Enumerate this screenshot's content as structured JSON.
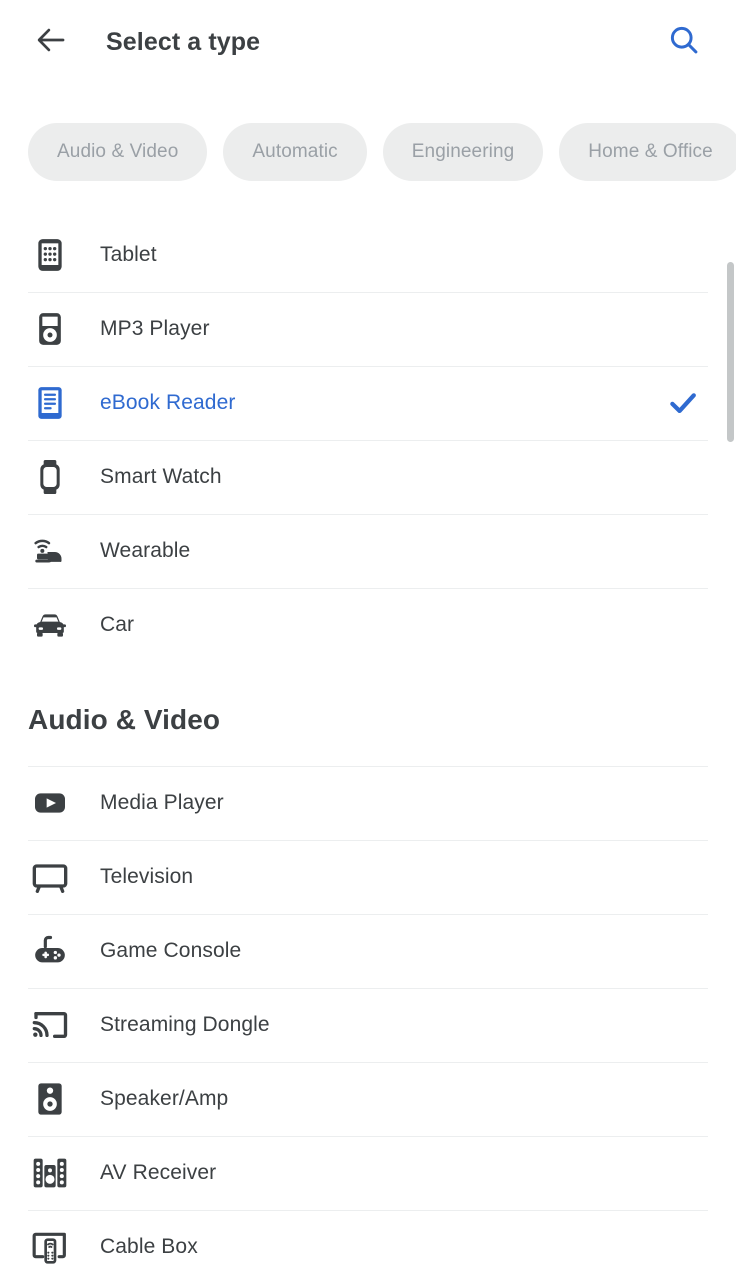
{
  "header": {
    "back_icon": "arrow-left-icon",
    "title": "Select a type",
    "search_icon": "search-icon",
    "search_icon_color": "#2f6ad0",
    "title_color": "#3c4043"
  },
  "filter_chips": [
    {
      "label": "Audio & Video"
    },
    {
      "label": "Automatic"
    },
    {
      "label": "Engineering"
    },
    {
      "label": "Home & Office"
    }
  ],
  "chip_style": {
    "background": "#eceded",
    "text_color": "#9aa0a6"
  },
  "selection": {
    "selected_label": "eBook Reader",
    "accent_color": "#2f6ad0",
    "check_icon": "check-icon"
  },
  "list_top": [
    {
      "label": "Tablet",
      "icon": "tablet-icon",
      "selected": false
    },
    {
      "label": "MP3 Player",
      "icon": "mp3-player-icon",
      "selected": false
    },
    {
      "label": "eBook Reader",
      "icon": "ebook-reader-icon",
      "selected": true
    },
    {
      "label": "Smart Watch",
      "icon": "smart-watch-icon",
      "selected": false
    },
    {
      "label": "Wearable",
      "icon": "wearable-icon",
      "selected": false
    },
    {
      "label": "Car",
      "icon": "car-icon",
      "selected": false
    }
  ],
  "section": {
    "title": "Audio & Video",
    "items": [
      {
        "label": "Media Player",
        "icon": "media-player-icon",
        "selected": false
      },
      {
        "label": "Television",
        "icon": "television-icon",
        "selected": false
      },
      {
        "label": "Game Console",
        "icon": "game-console-icon",
        "selected": false
      },
      {
        "label": "Streaming Dongle",
        "icon": "streaming-dongle-icon",
        "selected": false
      },
      {
        "label": "Speaker/Amp",
        "icon": "speaker-amp-icon",
        "selected": false
      },
      {
        "label": "AV Receiver",
        "icon": "av-receiver-icon",
        "selected": false
      },
      {
        "label": "Cable Box",
        "icon": "cable-box-icon",
        "selected": false
      }
    ]
  }
}
